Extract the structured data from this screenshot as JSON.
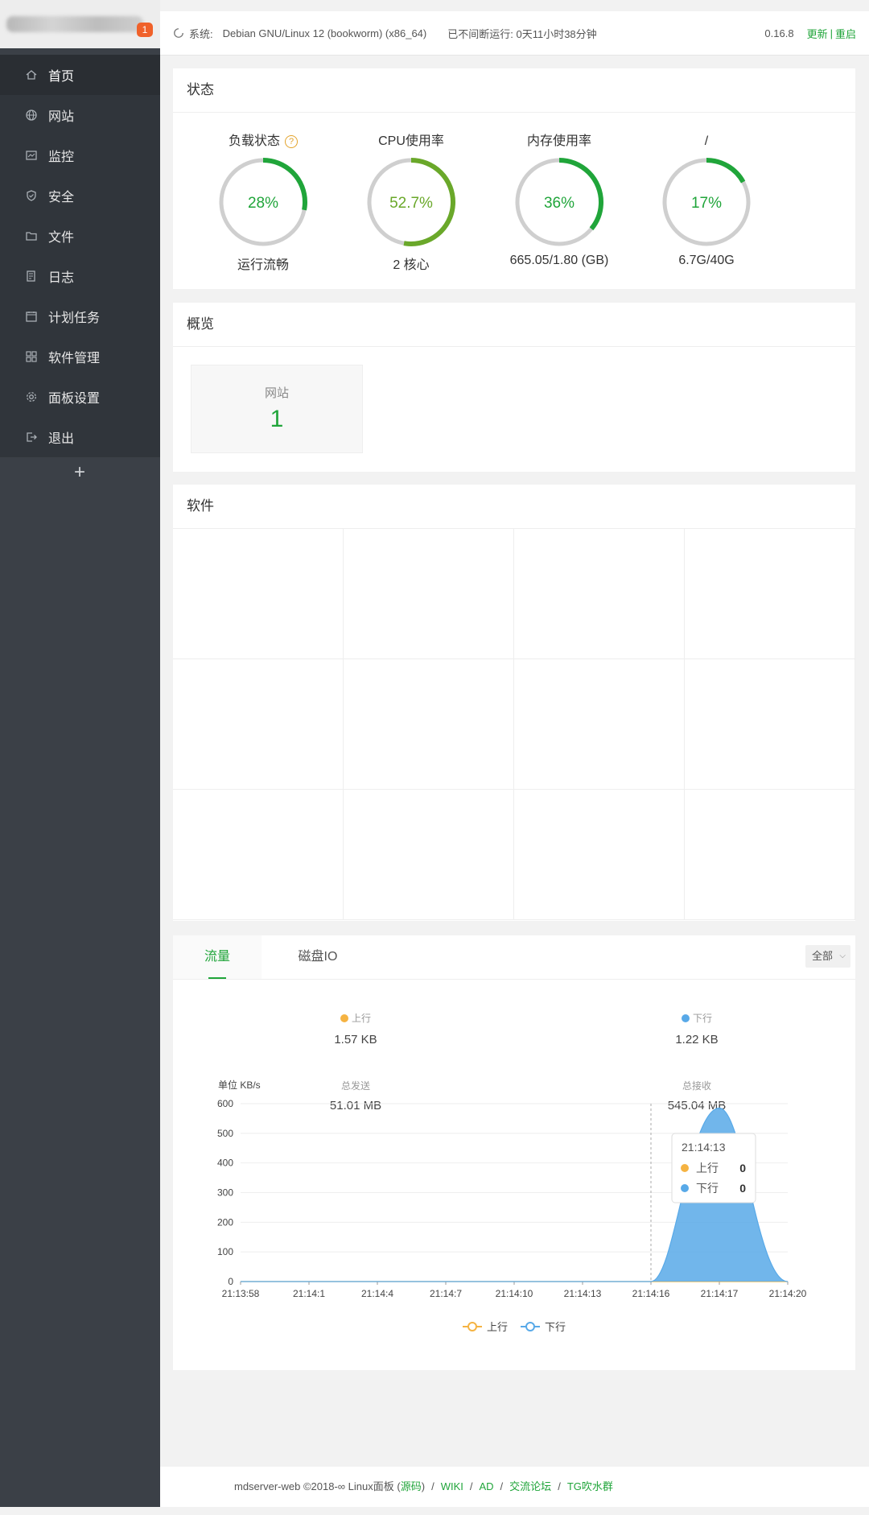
{
  "brand": {
    "badge": "1"
  },
  "sidebar": {
    "items": [
      {
        "label": "首页",
        "icon": "home-icon",
        "active": true
      },
      {
        "label": "网站",
        "icon": "globe-icon"
      },
      {
        "label": "监控",
        "icon": "monitor-icon"
      },
      {
        "label": "安全",
        "icon": "shield-icon"
      },
      {
        "label": "文件",
        "icon": "folder-icon"
      },
      {
        "label": "日志",
        "icon": "log-icon"
      },
      {
        "label": "计划任务",
        "icon": "calendar-icon"
      },
      {
        "label": "软件管理",
        "icon": "grid-icon"
      },
      {
        "label": "面板设置",
        "icon": "gear-icon"
      },
      {
        "label": "退出",
        "icon": "logout-icon"
      }
    ],
    "add": "+"
  },
  "topbar": {
    "sys_label": "系统:",
    "sys_value": "Debian GNU/Linux 12 (bookworm) (x86_64)",
    "uptime": "已不间断运行: 0天11小时38分钟",
    "version": "0.16.8",
    "update": "更新",
    "sep": "|",
    "restart": "重启"
  },
  "status": {
    "title": "状态",
    "gauges": [
      {
        "title": "负载状态",
        "help": "?",
        "value": "28%",
        "percent": 28,
        "foot": "运行流畅",
        "color": "#20a53a"
      },
      {
        "title": "CPU使用率",
        "value": "52.7%",
        "percent": 52.7,
        "foot": "2 核心",
        "color": "#6aa82a"
      },
      {
        "title": "内存使用率",
        "value": "36%",
        "percent": 36,
        "foot": "665.05/1.80 (GB)",
        "color": "#20a53a"
      },
      {
        "title": "/",
        "value": "17%",
        "percent": 17,
        "foot": "6.7G/40G",
        "color": "#20a53a"
      }
    ]
  },
  "overview": {
    "title": "概览",
    "card_label": "网站",
    "card_value": "1"
  },
  "software": {
    "title": "软件"
  },
  "traffic": {
    "tabs": [
      "流量",
      "磁盘IO"
    ],
    "range": "全部",
    "up": {
      "label": "上行",
      "value": "1.57 KB",
      "total_label": "总发送",
      "total": "51.01 MB",
      "color": "#f5b342"
    },
    "down": {
      "label": "下行",
      "value": "1.22 KB",
      "total_label": "总接收",
      "total": "545.04 MB",
      "color": "#58a9e8"
    },
    "tooltip": {
      "time": "21:14:13",
      "up_label": "上行",
      "up_value": "0",
      "down_label": "下行",
      "down_value": "0"
    }
  },
  "chart_data": {
    "type": "area",
    "ylabel": "单位 KB/s",
    "ylim": [
      0,
      600
    ],
    "yticks": [
      0,
      100,
      200,
      300,
      400,
      500,
      600
    ],
    "categories": [
      "21:13:58",
      "21:14:1",
      "21:14:4",
      "21:14:7",
      "21:14:10",
      "21:14:13",
      "21:14:16",
      "21:14:17",
      "21:14:20"
    ],
    "series": [
      {
        "name": "上行",
        "color": "#f5b342",
        "values": [
          0,
          0,
          0,
          0,
          0,
          0,
          0,
          0,
          0
        ]
      },
      {
        "name": "下行",
        "color": "#58a9e8",
        "values": [
          0,
          0,
          0,
          0,
          0,
          0,
          0,
          585,
          0
        ]
      }
    ],
    "legend": "bottom",
    "grid": true
  },
  "footer": {
    "text1": "mdserver-web ©2018-∞ Linux面板 (",
    "source": "源码",
    "text2": ")",
    "links": [
      "WIKI",
      "AD",
      "交流论坛",
      "TG吹水群"
    ],
    "sep": "/"
  }
}
